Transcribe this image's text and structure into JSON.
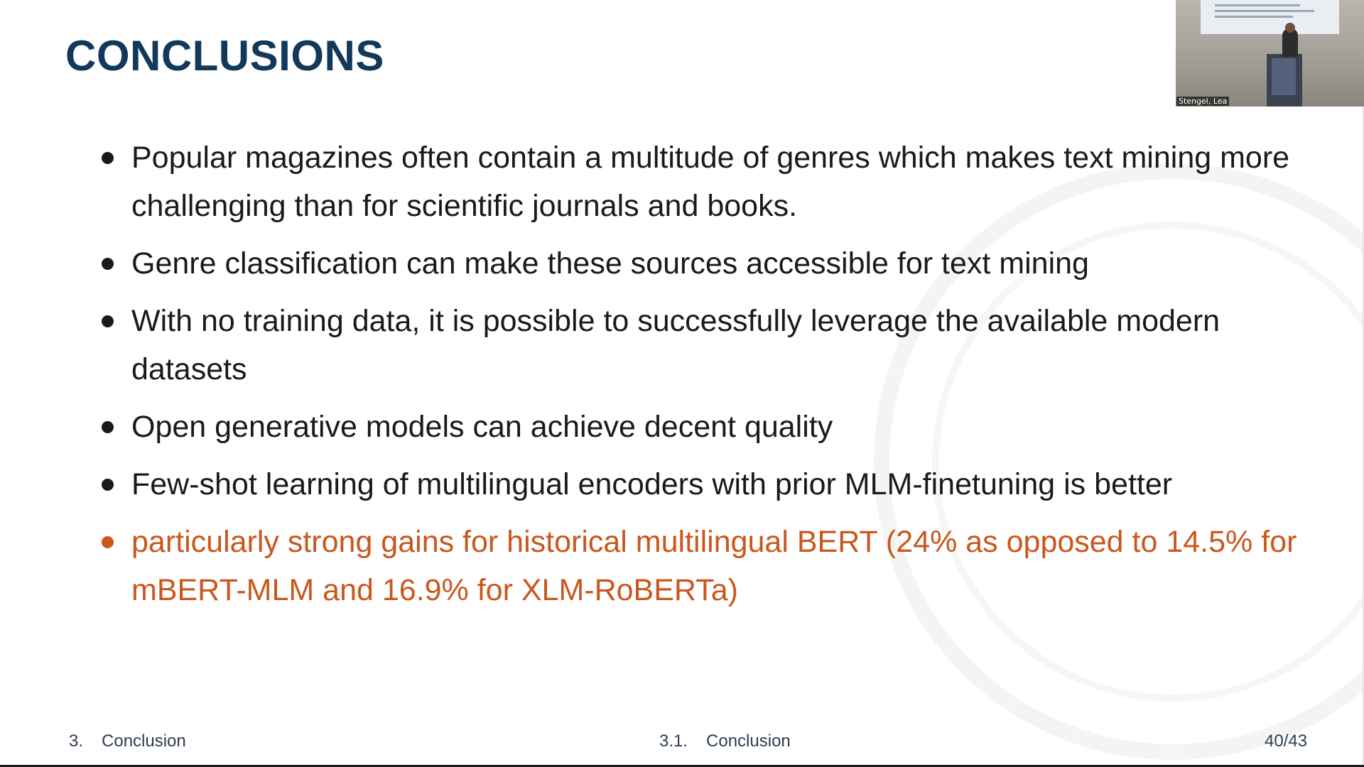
{
  "slide": {
    "title": "CONCLUSIONS",
    "bullets": [
      "Popular magazines often contain a multitude of genres which makes text mining more challenging than for scientific journals and books.",
      "Genre classification can make these sources accessible for text mining",
      "With no training data, it is possible to successfully leverage the available modern datasets",
      "Open generative models can achieve decent quality",
      "Few-shot learning of multilingual encoders with prior MLM-finetuning is better",
      "particularly strong gains for historical multilingual BERT (24% as opposed to 14.5% for mBERT-MLM and 16.9% for XLM-RoBERTa)"
    ],
    "colors": {
      "title": "#12385a",
      "text": "#1a1a1a",
      "highlight": "#c9571e"
    }
  },
  "footer": {
    "section_number": "3.",
    "section_name": "Conclusion",
    "subsection_number": "3.1.",
    "subsection_name": "Conclusion",
    "page": "40/43"
  },
  "webcam": {
    "participant_name": "Stengel, Lea"
  }
}
